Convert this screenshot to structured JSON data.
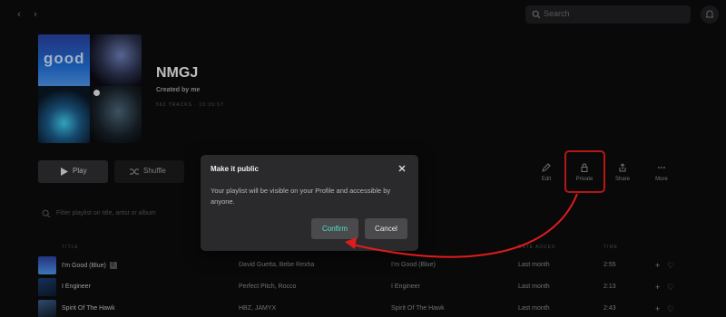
{
  "search": {
    "placeholder": "Search"
  },
  "playlist": {
    "cover_word": "good",
    "title": "NMGJ",
    "owner": "Created by me",
    "meta": "563 TRACKS · 10:39:57"
  },
  "actions": {
    "play": "Play",
    "shuffle": "Shuffle",
    "edit": "Edit",
    "privacy": "Private",
    "share": "Share",
    "more": "More"
  },
  "filter": {
    "placeholder": "Filter playlist on title, artist or album"
  },
  "table": {
    "headers": {
      "title": "TITLE",
      "date_added": "DATE ADDED",
      "time": "TIME"
    },
    "rows": [
      {
        "title": "I'm Good (Blue)",
        "explicit": "E",
        "artist": "David Guetta, Bebe Rexha",
        "album": "I'm Good (Blue)",
        "added": "Last month",
        "time": "2:55"
      },
      {
        "title": "I Engineer",
        "explicit": "",
        "artist": "Perfect Pitch, Rocco",
        "album": "I Engineer",
        "added": "Last month",
        "time": "2:13"
      },
      {
        "title": "Spirit Of The Hawk",
        "explicit": "",
        "artist": "HBZ, JAMYX",
        "album": "Spirit Of The Hawk",
        "added": "Last month",
        "time": "2:43"
      }
    ]
  },
  "modal": {
    "title": "Make it public",
    "body": "Your playlist will be visible on your Profile and accessible by anyone.",
    "confirm": "Confirm",
    "cancel": "Cancel"
  },
  "colors": {
    "accent": "#4fe2cc",
    "annotation": "#e01b1b",
    "background": "#0b0b0c",
    "dialog": "#2a2a2c"
  },
  "icons": [
    "back-icon",
    "forward-icon",
    "search-icon",
    "bell-icon",
    "play-icon",
    "shuffle-icon",
    "pencil-icon",
    "lock-icon",
    "share-icon",
    "more-icon",
    "close-icon",
    "plus-icon",
    "heart-icon"
  ]
}
